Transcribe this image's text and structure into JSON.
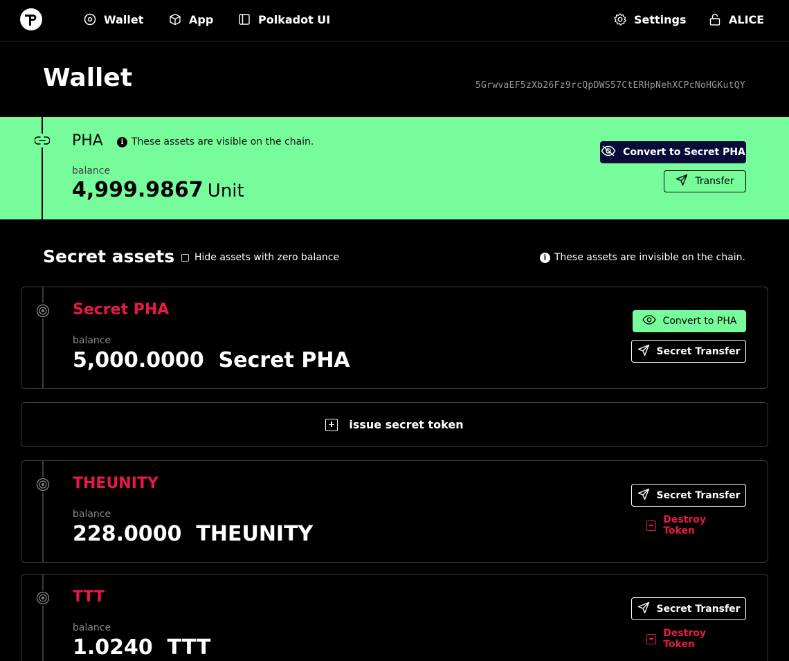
{
  "nav": {
    "logo_icon": "phala-logo-icon",
    "items": [
      {
        "label": "Wallet",
        "icon": "target-circle-icon"
      },
      {
        "label": "App",
        "icon": "cube-icon"
      },
      {
        "label": "Polkadot UI",
        "icon": "sidebar-panel-icon"
      }
    ],
    "settings_label": "Settings",
    "account_label": "ALICE"
  },
  "header": {
    "title": "Wallet",
    "address": "5GrwvaEF5zXb26Fz9rcQpDWS57CtERHpNehXCPcNoHGKutQY"
  },
  "pha": {
    "name": "PHA",
    "info": "These assets are visible on the chain.",
    "balance_label": "balance",
    "balance": "4,999.9867",
    "unit": "Unit",
    "convert_label": "Convert to Secret PHA",
    "transfer_label": "Transfer",
    "background_color": "#77fc9b"
  },
  "secret": {
    "title": "Secret assets",
    "hide_zero_label": "Hide assets with zero balance",
    "hide_zero_checked": false,
    "info": "These assets are invisible on the chain."
  },
  "assets": [
    {
      "name": "Secret PHA",
      "balance_label": "balance",
      "balance_text": "5,000.0000  Secret PHA",
      "convert_label": "Convert to PHA",
      "transfer_label": "Secret Transfer"
    },
    {
      "name": "THEUNITY",
      "balance_label": "balance",
      "balance_text": "228.0000  THEUNITY",
      "transfer_label": "Secret Transfer",
      "destroy_label": "Destroy Token"
    },
    {
      "name": "TTT",
      "balance_label": "balance",
      "balance_text": "1.0240  TTT",
      "transfer_label": "Secret Transfer",
      "destroy_label": "Destroy Token"
    }
  ],
  "issue": {
    "label": "issue secret token"
  },
  "colors": {
    "accent_green": "#77fc9b",
    "accent_red": "#e8194a",
    "navy_button": "#0b0b3a"
  }
}
